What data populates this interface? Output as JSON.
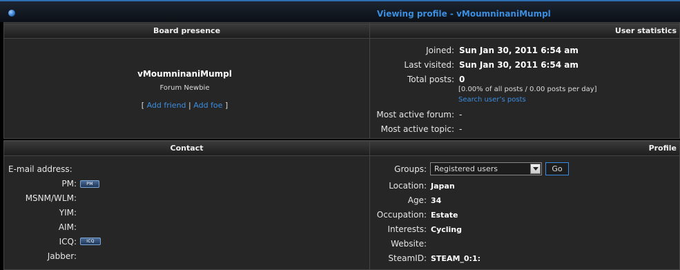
{
  "window": {
    "title": "Viewing profile - vMoumninaniMumpl"
  },
  "board_presence": {
    "header": "Board presence",
    "username": "vMoumninaniMumpl",
    "rank": "Forum Newbie",
    "links_prefix": "[",
    "add_friend": "Add friend",
    "links_separator": "|",
    "add_foe": "Add foe",
    "links_suffix": "]"
  },
  "user_statistics": {
    "header": "User statistics",
    "joined_label": "Joined:",
    "joined_value": "Sun Jan 30, 2011 6:54 am",
    "last_visited_label": "Last visited:",
    "last_visited_value": "Sun Jan 30, 2011 6:54 am",
    "total_posts_label": "Total posts:",
    "total_posts_value": "0",
    "posts_detail": "[0.00% of all posts / 0.00 posts per day]",
    "search_posts_link": "Search user’s posts",
    "most_active_forum_label": "Most active forum:",
    "most_active_forum_value": "-",
    "most_active_topic_label": "Most active topic:",
    "most_active_topic_value": "-"
  },
  "contact": {
    "header": "Contact",
    "email_label": "E-mail address:",
    "pm_label": "PM:",
    "pm_icon_text": "PM",
    "msnm_label": "MSNM/WLM:",
    "yim_label": "YIM:",
    "aim_label": "AIM:",
    "icq_label": "ICQ:",
    "icq_icon_text": "ICQ",
    "jabber_label": "Jabber:"
  },
  "profile": {
    "header": "Profile",
    "groups_label": "Groups:",
    "groups_selected": "Registered users",
    "go_button": "Go",
    "location_label": "Location:",
    "location_value": "Japan",
    "age_label": "Age:",
    "age_value": "34",
    "occupation_label": "Occupation:",
    "occupation_value": "Estate",
    "interests_label": "Interests:",
    "interests_value": "Cycling",
    "website_label": "Website:",
    "steamid_label": "SteamID:",
    "steamid_value": "STEAM_0:1:"
  }
}
